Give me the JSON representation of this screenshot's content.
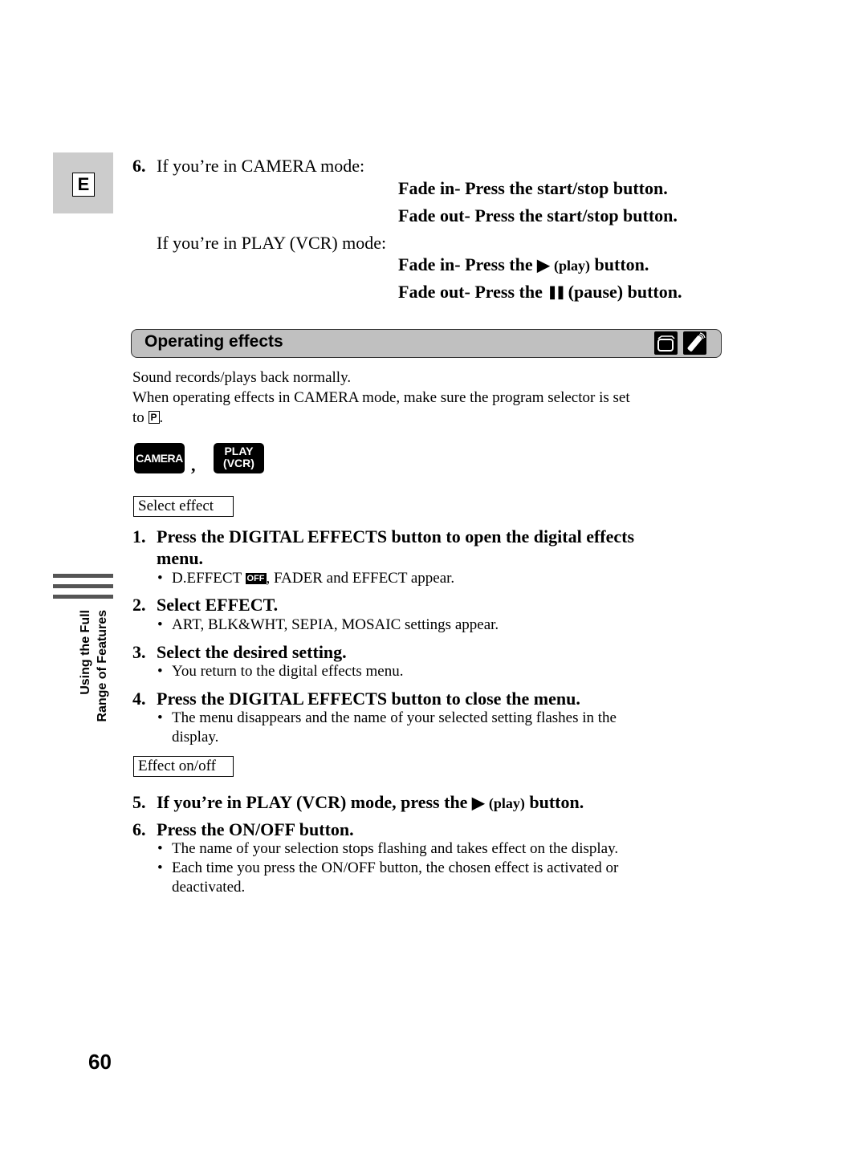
{
  "language_tab": {
    "letter": "E"
  },
  "side_title": {
    "line1": "Using the Full",
    "line2": "Range of Features"
  },
  "fade_section": {
    "step_number": "6.",
    "camera_mode_label": "If you’re in CAMERA mode:",
    "camera_fade_in": "Fade in- Press the start/stop button.",
    "camera_fade_out": "Fade out- Press the start/stop button.",
    "vcr_mode_label": "If you’re in PLAY (VCR) mode:",
    "vcr_fade_in_prefix": "Fade in- Press the",
    "vcr_fade_in_paren": "(play)",
    "vcr_fade_in_suffix": "button.",
    "vcr_fade_out_prefix": "Fade out- Press the",
    "vcr_fade_out_paren": "(pause)",
    "vcr_fade_out_suffix": "button.",
    "play_icon": "▶",
    "pause_icon": "❚❚"
  },
  "section_header": {
    "title": "Operating effects",
    "icons": [
      "camcorder-icon",
      "remote-control-icon"
    ]
  },
  "intro": {
    "line1": "Sound records/plays back normally.",
    "line2": "When operating effects in CAMERA mode, make sure the program selector is set",
    "line3_prefix": "to",
    "program_symbol": "P",
    "line3_suffix": "."
  },
  "mode_badges": {
    "camera": "CAMERA",
    "separator": ",",
    "play_line1": "PLAY",
    "play_line2": "(VCR)"
  },
  "labels": {
    "select_effect": "Select effect",
    "effect_on_off": "Effect on/off"
  },
  "steps": [
    {
      "num": "1.",
      "text_line1": "Press the DIGITAL EFFECTS button to open the digital effects",
      "text_line2": "menu.",
      "bullets": [
        {
          "prefix": "D.EFFECT",
          "badge": "OFF",
          "suffix": ", FADER and EFFECT appear."
        }
      ]
    },
    {
      "num": "2.",
      "text": "Select EFFECT.",
      "bullets": [
        "ART, BLK&WHT, SEPIA, MOSAIC settings appear."
      ]
    },
    {
      "num": "3.",
      "text": "Select the desired setting.",
      "bullets": [
        "You return to the digital effects menu."
      ]
    },
    {
      "num": "4.",
      "text": "Press the DIGITAL EFFECTS button to close the menu.",
      "bullets": [
        "The menu disappears and the name of your selected setting flashes in the",
        "display."
      ]
    },
    {
      "num": "5.",
      "text_prefix": "If you’re in PLAY (VCR) mode, press the",
      "icon": "▶",
      "paren": "(play)",
      "text_suffix": "button."
    },
    {
      "num": "6.",
      "text": "Press the ON/OFF button.",
      "bullets": [
        "The name of your selection stops flashing and takes effect on the display.",
        "Each time you press the ON/OFF button, the chosen effect is activated or",
        "deactivated."
      ]
    }
  ],
  "bullet_char": "•",
  "page_number": "60"
}
